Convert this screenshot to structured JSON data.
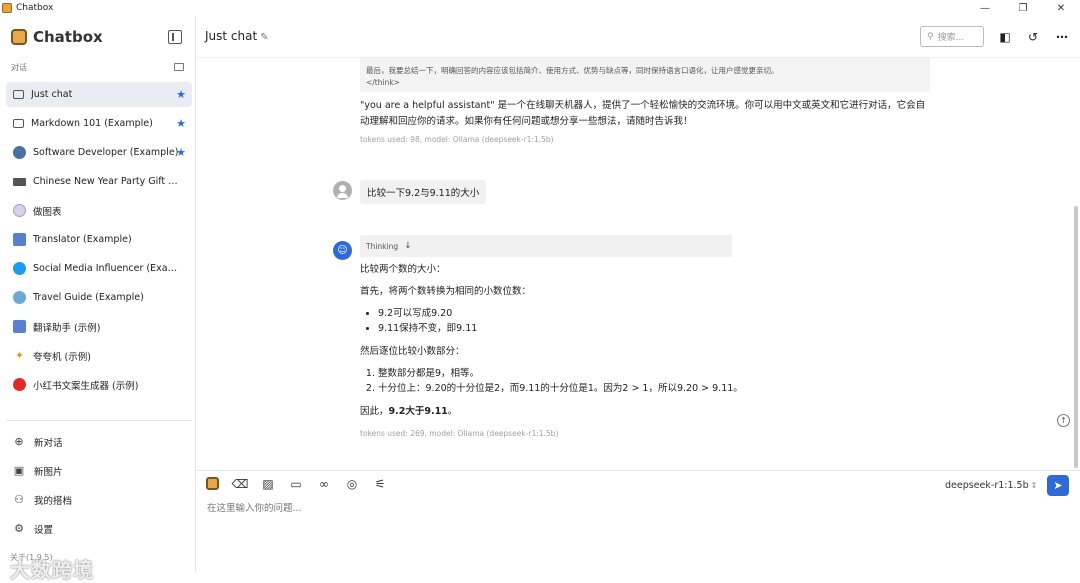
{
  "window": {
    "title": "Chatbox",
    "controls": {
      "minimize": "—",
      "maximize": "❐",
      "close": "✕"
    }
  },
  "sidebar": {
    "brand": "Chatbox",
    "section_label": "对话",
    "items": [
      {
        "label": "Just chat",
        "icon": "chat-bubble-icon",
        "starred": true,
        "active": true
      },
      {
        "label": "Markdown 101 (Example)",
        "icon": "chat-bubble-icon",
        "starred": true
      },
      {
        "label": "Software Developer (Example)",
        "icon": "developer-avatar",
        "starred": true
      },
      {
        "label": "Chinese New Year Party Gift Exc...",
        "icon": "gift-avatar",
        "starred": false
      },
      {
        "label": "做图表",
        "icon": "chart-avatar",
        "starred": false
      },
      {
        "label": "Translator (Example)",
        "icon": "translator-avatar",
        "starred": false
      },
      {
        "label": "Social Media Influencer (Example)",
        "icon": "twitter-avatar",
        "starred": false
      },
      {
        "label": "Travel Guide (Example)",
        "icon": "globe-avatar",
        "starred": false
      },
      {
        "label": "翻译助手 (示例)",
        "icon": "translator-avatar",
        "starred": false
      },
      {
        "label": "夸夸机 (示例)",
        "icon": "sparkle-avatar",
        "starred": false
      },
      {
        "label": "小红书文案生成器 (示例)",
        "icon": "xiaohongshu-avatar",
        "starred": false
      }
    ],
    "bottom_menu": [
      {
        "label": "新对话",
        "icon": "plus-circle-icon"
      },
      {
        "label": "新图片",
        "icon": "image-icon"
      },
      {
        "label": "我的搭档",
        "icon": "robot-icon"
      },
      {
        "label": "设置",
        "icon": "gear-icon"
      }
    ],
    "about": "关于(1.9.5)",
    "watermark": "大数跨境"
  },
  "header": {
    "title": "Just chat",
    "search_placeholder": "搜索..."
  },
  "conversation": {
    "think_block_line1": "最后，我要总结一下，明确回答的内容应该包括简介、使用方式、优势与缺点等，同时保持语言口语化，让用户感觉更亲切。",
    "think_block_line2": "</think>",
    "prev_reply": "\"you are a helpful assistant\" 是一个在线聊天机器人，提供了一个轻松愉快的交流环境。你可以用中文或英文和它进行对话，它会自动理解和回应你的请求。如果你有任何问题或想分享一些想法，请随时告诉我！",
    "prev_meta": "tokens used: 98, model: Ollama (deepseek-r1:1.5b)",
    "user_message": "比较一下9.2与9.11的大小",
    "thinking_label": "Thinking",
    "reply_intro": "比较两个数的大小：",
    "reply_step1": "首先，将两个数转换为相同的小数位数：",
    "reply_bullets": [
      "9.2可以写成9.20",
      "9.11保持不变，即9.11"
    ],
    "reply_step2": "然后逐位比较小数部分：",
    "reply_numbered": [
      "整数部分都是9，相等。",
      "十分位上：9.20的十分位是2，而9.11的十分位是1。因为2 > 1，所以9.20 > 9.11。"
    ],
    "reply_conclusion_prefix": "因此，",
    "reply_conclusion_bold": "9.2大于9.11",
    "reply_conclusion_suffix": "。",
    "reply_meta": "tokens used: 269, model: Ollama (deepseek-r1:1.5b)"
  },
  "composer": {
    "model": "deepseek-r1:1.5b",
    "placeholder": "在这里输入你的问题..."
  },
  "colors": {
    "accent": "#2f6bd6",
    "active_bg": "#e9ecf3",
    "brand": "#e9a84a"
  }
}
